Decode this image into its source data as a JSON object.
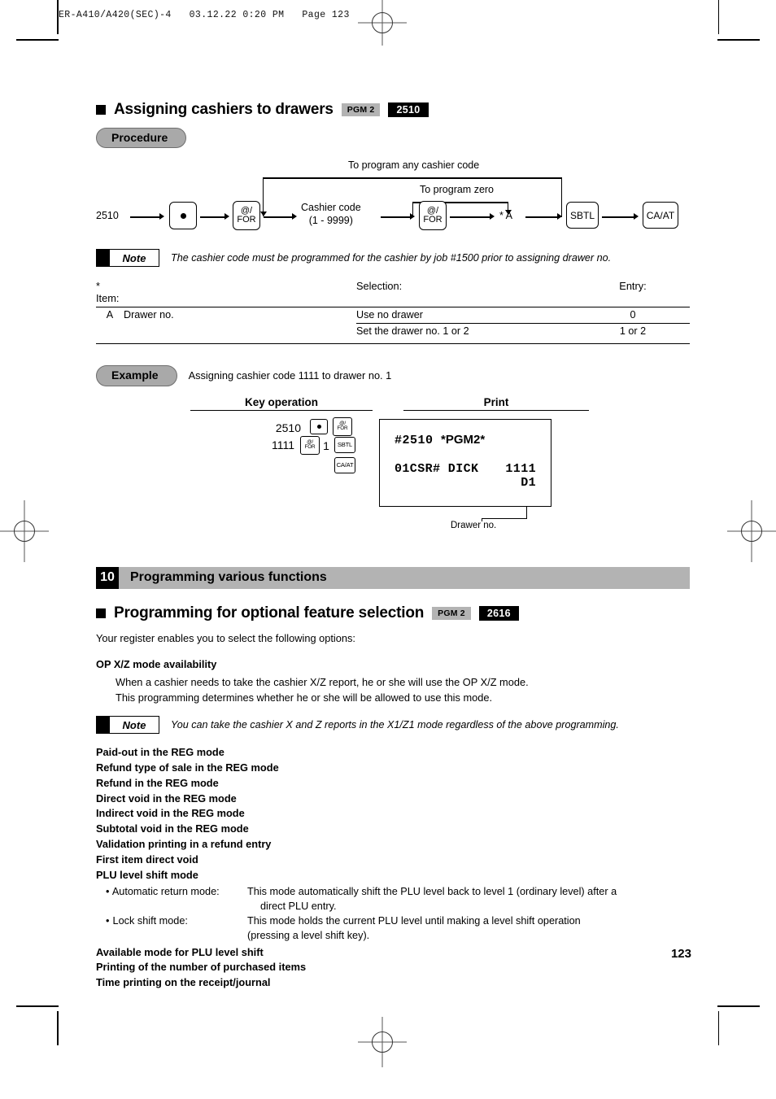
{
  "page_header": "ER-A410/A420(SEC)-4   03.12.22 0:20 PM   Page 123",
  "page_number": "123",
  "section1": {
    "title": "Assigning cashiers to drawers",
    "badge_mode": "PGM 2",
    "badge_job": "2510",
    "procedure_label": "Procedure",
    "flow": {
      "start_code": "2510",
      "label_any_cashier": "To program any cashier code",
      "label_zero": "To program zero",
      "cashier_code_line1": "Cashier code",
      "cashier_code_line2": "(1 - 9999)",
      "star_a": "* A",
      "key_dot": "●",
      "key_for_line1": "@/",
      "key_for_line2": "FOR",
      "key_sbtl": "SBTL",
      "key_caat": "CA/AT"
    },
    "note": "The cashier code must be programmed for the cashier by job #1500 prior to assigning drawer no.",
    "note_tag": "Note",
    "table": {
      "headers": [
        "* Item:",
        "",
        "Selection:",
        "Entry:"
      ],
      "rows": [
        {
          "item": "A",
          "name": "Drawer no.",
          "selection": "Use no drawer",
          "entry": "0"
        },
        {
          "item": "",
          "name": "",
          "selection": "Set the drawer no. 1 or 2",
          "entry": "1 or 2"
        }
      ]
    },
    "example": {
      "label": "Example",
      "description": "Assigning cashier code 1111 to drawer no. 1",
      "col_key_operation": "Key operation",
      "col_print": "Print",
      "keyop": {
        "line1_num": "2510",
        "line2_num": "1111",
        "line2_mid": "1",
        "key_dot": "●",
        "key_for_1": "@/",
        "key_for_2": "FOR",
        "key_sbtl": "SBTL",
        "key_caat": "CA/AT"
      },
      "receipt": {
        "line1_code": "#2510",
        "line1_mode": "*PGM2*",
        "line2_left": "01CSR# DICK",
        "line2_right": "1111",
        "line3": "D1",
        "callout": "Drawer no."
      }
    }
  },
  "chapter": {
    "number": "10",
    "title": "Programming various functions"
  },
  "section2": {
    "title": "Programming for optional feature selection",
    "badge_mode": "PGM 2",
    "badge_job": "2616",
    "intro": "Your register enables you to select the following options:",
    "subhead": "OP X/Z mode availability",
    "sub_line1": "When a cashier needs to take the cashier X/Z report, he or she will use the OP X/Z mode.",
    "sub_line2": "This programming determines whether he or she will be allowed to use this mode.",
    "note_tag": "Note",
    "note": "You can take the cashier X and Z reports in the X1/Z1 mode regardless of the above programming.",
    "options": [
      "Paid-out in the REG mode",
      "Refund type of sale in the REG mode",
      "Refund in the REG mode",
      "Direct void in the REG mode",
      "Indirect void in the REG mode",
      "Subtotal void in the REG mode",
      "Validation printing in a refund entry",
      "First item direct void",
      "PLU level shift mode"
    ],
    "bullets": [
      {
        "label": "Automatic return mode:",
        "line1": "This mode automatically shift the PLU level back to level 1 (ordinary level) after a",
        "line2": "direct PLU entry."
      },
      {
        "label": "Lock shift mode:",
        "line1": "This mode holds the current PLU level until making a level shift operation",
        "line2": "(pressing a level shift key)."
      }
    ],
    "options_tail": [
      "Available mode for PLU level shift",
      "Printing of the number of purchased items",
      "Time printing on the receipt/journal"
    ]
  }
}
